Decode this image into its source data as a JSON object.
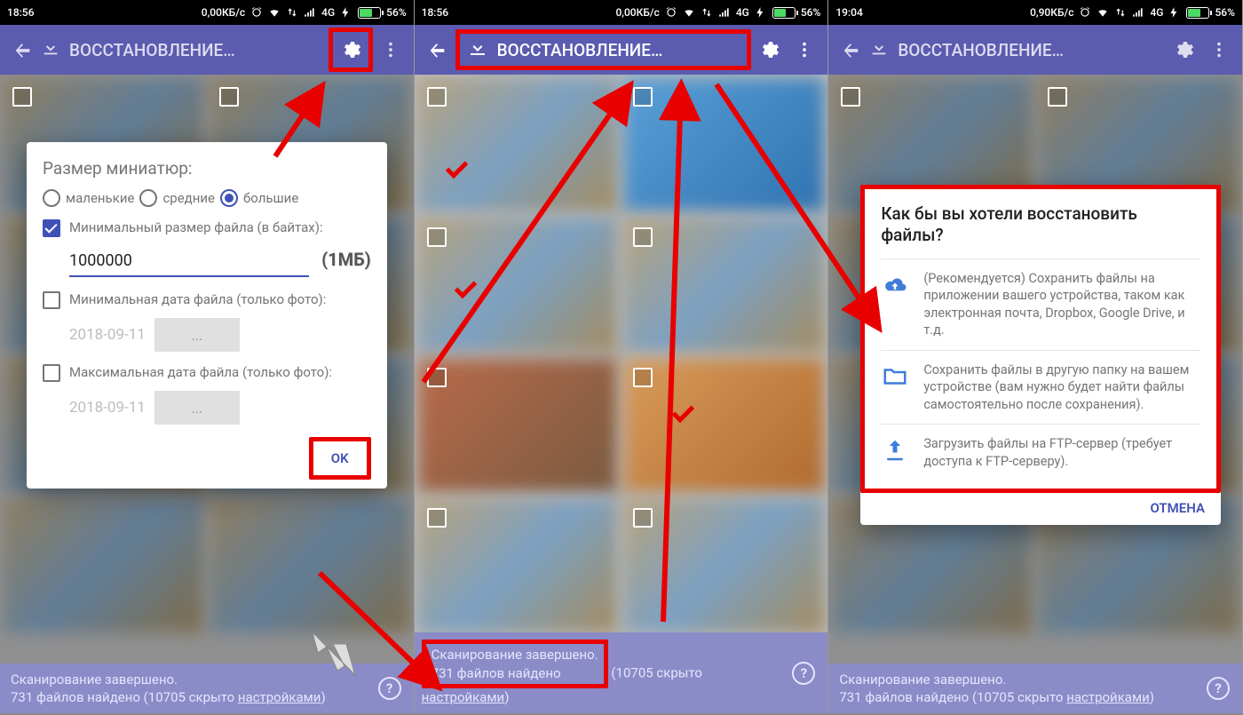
{
  "statusbar": {
    "time1": "18:56",
    "time2": "18:56",
    "time3": "19:04",
    "speed1": "0,00КБ/с",
    "speed3": "0,90КБ/с",
    "net": "4G",
    "batt_pct": "56%"
  },
  "appbar": {
    "title": "ВОССТАНОВЛЕНИЕ…"
  },
  "dialog_settings": {
    "heading": "Размер миниатюр:",
    "radio_small": "маленькие",
    "radio_medium": "средние",
    "radio_large": "большие",
    "cb_minsize": "Минимальный размер файла (в байтах):",
    "minsize_value": "1000000",
    "minsize_annot": "(1МБ)",
    "cb_mindate": "Минимальная дата файла (только фото):",
    "mindate_value": "2018-09-11",
    "date_btn": "...",
    "cb_maxdate": "Максимальная дата файла (только фото):",
    "maxdate_value": "2018-09-11",
    "ok": "OK"
  },
  "dialog_restore": {
    "heading": "Как бы вы хотели восстановить файлы?",
    "opt1": "(Рекомендуется) Сохранить файлы на приложении вашего устройства, таком как электронная почта, Dropbox, Google Drive, и т.д.",
    "opt2": "Сохранить файлы в другую папку на вашем устройстве (вам нужно будет найти файлы самостоятельно после сохранения).",
    "opt3": "Загрузить файлы на FTP-сервер (требует доступа к FTP-серверу).",
    "cancel": "ОТМЕНА"
  },
  "footer": {
    "line1": "Сканирование завершено.",
    "found": "731 файлов найдено",
    "hidden": "(10705 скрыто ",
    "settings_link": "настройками",
    "paren_close": ")",
    "help": "?"
  }
}
